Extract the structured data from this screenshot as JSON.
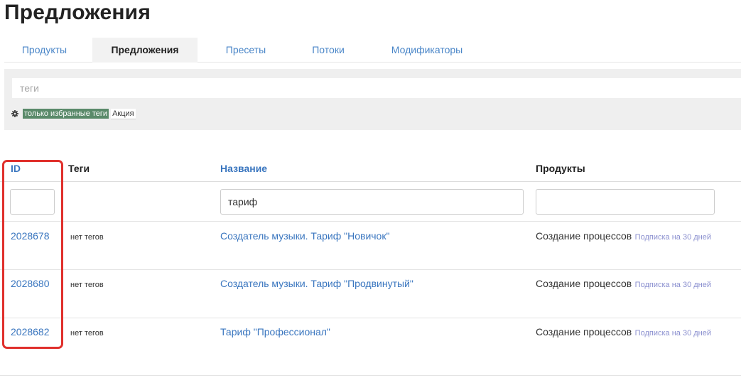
{
  "page": {
    "title": "Предложения"
  },
  "tabs": [
    {
      "label": "Продукты",
      "active": false
    },
    {
      "label": "Предложения",
      "active": true
    },
    {
      "label": "Пресеты",
      "active": false
    },
    {
      "label": "Потоки",
      "active": false
    },
    {
      "label": "Модификаторы",
      "active": false
    }
  ],
  "filter": {
    "tags_placeholder": "теги",
    "tags_value": "",
    "settings_icon": "gear-icon",
    "chips": [
      {
        "label": "только избранные теги",
        "selected": true
      },
      {
        "label": "Акция",
        "selected": false
      }
    ]
  },
  "table": {
    "columns": {
      "id": "ID",
      "tags": "Теги",
      "name": "Название",
      "products": "Продукты"
    },
    "filters": {
      "id": "",
      "name": "тариф",
      "products": ""
    },
    "rows": [
      {
        "id": "2028678",
        "tags": "нет тегов",
        "name": "Создатель музыки. Тариф \"Новичок\"",
        "product": "Создание процессов",
        "product_detail": "Подписка на 30 дней"
      },
      {
        "id": "2028680",
        "tags": "нет тегов",
        "name": "Создатель музыки. Тариф \"Продвинутый\"",
        "product": "Создание процессов",
        "product_detail": "Подписка на 30 дней"
      },
      {
        "id": "2028682",
        "tags": "нет тегов",
        "name": "Тариф \"Профессионал\"",
        "product": "Создание процессов",
        "product_detail": "Подписка на 30 дней"
      }
    ]
  },
  "colors": {
    "link": "#3a76bf",
    "highlight": "#e0302c",
    "selected_chip": "#5a8a6a",
    "panel": "#efefef"
  }
}
